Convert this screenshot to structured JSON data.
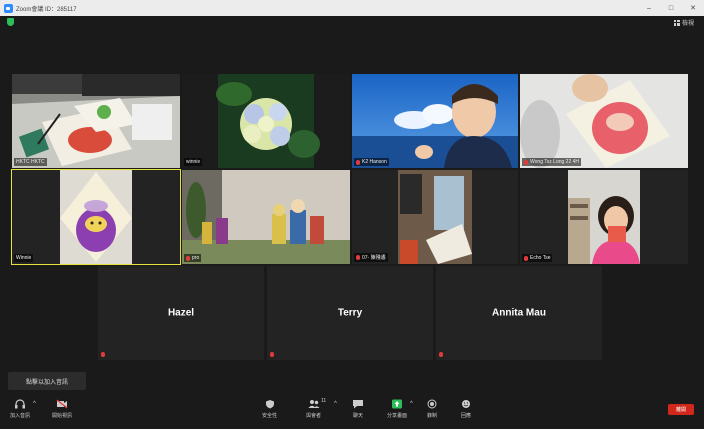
{
  "window": {
    "title": "Zoom會議 ID：285117",
    "min": "–",
    "max": "□",
    "close": "✕"
  },
  "topbar": {
    "view_label": "檢視"
  },
  "participants_row1": [
    {
      "name": "HKTC HKTC",
      "muted": false
    },
    {
      "name": "winnie",
      "muted": false
    },
    {
      "name": "K2 Hanson",
      "muted": true
    },
    {
      "name": "Wong Tsz Long 22 4H",
      "muted": true
    }
  ],
  "participants_row2": [
    {
      "name": "Winnie",
      "muted": false
    },
    {
      "name": "pro",
      "muted": true
    },
    {
      "name": "07- 陳殘遹",
      "muted": true
    },
    {
      "name": "Echo Tse",
      "muted": true
    }
  ],
  "participants_row3": [
    {
      "name": "Hazel",
      "muted": true
    },
    {
      "name": "Terry",
      "muted": true
    },
    {
      "name": "Annita Mau",
      "muted": true
    }
  ],
  "join_audio_prompt": "點擊以加入音訊",
  "toolbar": {
    "join_audio": "加入音訊",
    "start_video": "開始視訊",
    "security": "安全性",
    "participants": "與會者",
    "participant_count": "11",
    "chat": "聊天",
    "share_screen": "分享畫面",
    "record": "錄制",
    "reactions": "回應",
    "end": "離開"
  },
  "colors": {
    "accent": "#2d8cff",
    "active_speaker": "#e8e33a",
    "share_green": "#2bbf5a",
    "end_red": "#d1281b",
    "muted_red": "#e23b3b"
  }
}
